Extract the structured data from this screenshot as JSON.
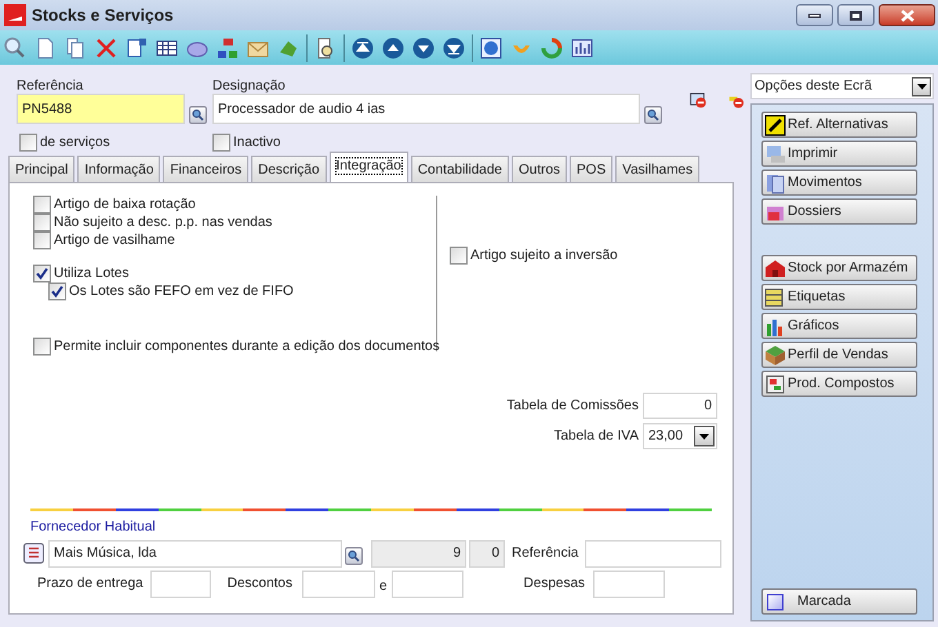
{
  "window": {
    "title": "Stocks e Serviços"
  },
  "form": {
    "reference": {
      "label": "Referência",
      "value": "PN5488"
    },
    "designation": {
      "label": "Designação",
      "value": "Processador de audio 4 ias"
    },
    "checkboxes": [
      {
        "label": "de serviços",
        "checked": false
      },
      {
        "label": "Inactivo",
        "checked": false
      }
    ]
  },
  "tabs": [
    {
      "label": "Principal",
      "selected": false
    },
    {
      "label": "Informação",
      "selected": false
    },
    {
      "label": "Financeiros",
      "selected": false
    },
    {
      "label": "Descrição",
      "selected": false
    },
    {
      "label": "Integração",
      "selected": true
    },
    {
      "label": "Contabilidade",
      "selected": false
    },
    {
      "label": "Outros",
      "selected": false
    },
    {
      "label": "POS",
      "selected": false
    },
    {
      "label": "Vasilhames",
      "selected": false
    }
  ],
  "integration": {
    "option_groups": [
      {
        "options": [
          {
            "label": "Artigo de baixa rotação",
            "checked": false
          },
          {
            "label": "Não sujeito a desc. p.p. nas vendas",
            "checked": false
          },
          {
            "label": "Artigo de vasilhame",
            "checked": false
          }
        ]
      },
      {
        "options": [
          {
            "label": "Utiliza Lotes",
            "checked": true,
            "children": [
              {
                "label": "Os Lotes são FEFO em vez de FIFO",
                "checked": true
              }
            ]
          }
        ]
      },
      {
        "options": [
          {
            "label": "Permite incluir componentes durante a edição dos documentos",
            "checked": false
          }
        ]
      }
    ],
    "right_option": {
      "label": "Artigo sujeito a inversão",
      "checked": false
    },
    "commission_table": {
      "label": "Tabela de Comissões",
      "value": "0"
    },
    "vat_table": {
      "label": "Tabela de IVA",
      "value": "23,00"
    },
    "supplier": {
      "title": "Fornecedor Habitual",
      "name": "Mais Música, lda",
      "number": "9",
      "sub_number": "0",
      "reference_label": "Referência",
      "delivery_label": "Prazo de entrega",
      "discounts_label": "Descontos",
      "and_label": "e",
      "expenses_label": "Despesas"
    }
  },
  "side_panel": {
    "dropdown": "Opções deste Ecrã",
    "button_groups": [
      {
        "buttons": [
          "Ref. Alternativas",
          "Imprimir",
          "Movimentos",
          "Dossiers"
        ]
      },
      {
        "buttons": [
          "Stock por Armazém",
          "Etiquetas",
          "Gráficos",
          "Perfil de Vendas",
          "Prod. Compostos"
        ]
      }
    ],
    "marked": {
      "label": "Marcada",
      "checked": false
    }
  }
}
